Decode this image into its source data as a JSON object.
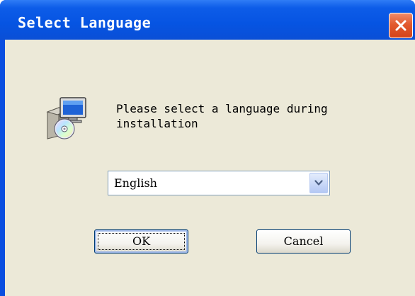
{
  "window": {
    "title": "Select Language"
  },
  "titlebar": {
    "close_icon": "close-icon",
    "close_color": "#d4431a"
  },
  "content": {
    "icon": "setup-installer-icon",
    "message": "Please select a language during installation"
  },
  "language_select": {
    "selected": "English",
    "arrow_icon": "chevron-down-icon"
  },
  "buttons": {
    "ok_label": "OK",
    "cancel_label": "Cancel"
  },
  "colors": {
    "titlebar": "#0654e2",
    "dialog_background": "#ece9d8",
    "button_border": "#003c74"
  }
}
